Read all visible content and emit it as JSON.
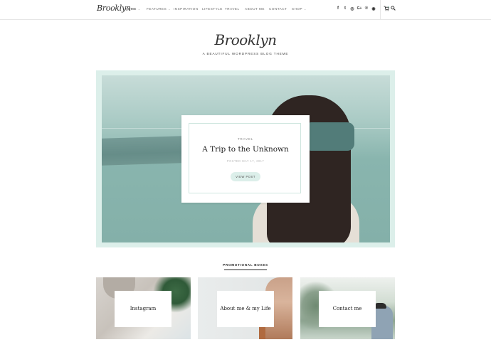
{
  "nav": {
    "logo": "Brooklyn",
    "items": [
      {
        "label": "Home",
        "caret": "⌄"
      },
      {
        "label": "Features",
        "caret": "⌄"
      },
      {
        "label": "Inspiration",
        "caret": ""
      },
      {
        "label": "Lifestyle",
        "caret": ""
      },
      {
        "label": "Travel",
        "caret": ""
      },
      {
        "label": "About me",
        "caret": ""
      },
      {
        "label": "Contact",
        "caret": ""
      },
      {
        "label": "Shop",
        "caret": "⌄"
      }
    ],
    "social": [
      "facebook-icon",
      "twitter-icon",
      "instagram-icon",
      "google-plus-icon",
      "pinterest-icon",
      "camera-icon"
    ],
    "social_glyphs": [
      "f",
      "t",
      "◎",
      "G+",
      "℗",
      "◉"
    ],
    "cart_count": "0"
  },
  "header": {
    "logo": "Brooklyn",
    "tagline": "A beautiful WordPress blog theme"
  },
  "hero": {
    "category": "Travel",
    "title": "A Trip to the Unknown",
    "date": "Posted May 17, 2017",
    "button": "View Post"
  },
  "promo": {
    "heading": "Promotional Boxes",
    "boxes": [
      {
        "label": "Instagram"
      },
      {
        "label": "About me & my Life"
      },
      {
        "label": "Contact me"
      }
    ]
  },
  "colors": {
    "accent": "#dcefea",
    "accent_border": "#cfe6df"
  }
}
